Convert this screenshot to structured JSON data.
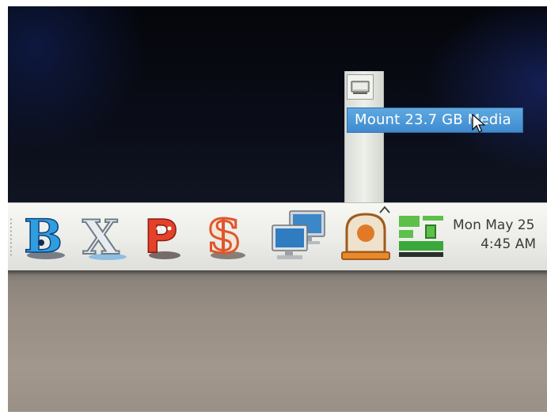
{
  "popup_menu": {
    "mount_item": "Mount 23.7 GB Media",
    "icon": "drive-icon"
  },
  "panel": {
    "launchers": [
      {
        "name": "blogger-app-icon",
        "glyph": "B",
        "color": "#2b8fd6"
      },
      {
        "name": "x-app-icon",
        "glyph": "X",
        "color": "#7d8b96"
      },
      {
        "name": "p-chat-app-icon",
        "glyph": "P",
        "color": "#e0402a"
      },
      {
        "name": "s-app-icon",
        "glyph": "S",
        "color": "#e2552c"
      }
    ],
    "network_icon": "network-computers-icon",
    "removable_media_icon": "removable-media-icon",
    "workspace_icon": "workspace-switcher-icon"
  },
  "clock": {
    "date": "Mon May 25",
    "time": "4:45 AM"
  },
  "colors": {
    "menu_highlight": "#3f8bcf",
    "panel_bg": "#ecece8",
    "clock_text": "#3a3a38"
  }
}
